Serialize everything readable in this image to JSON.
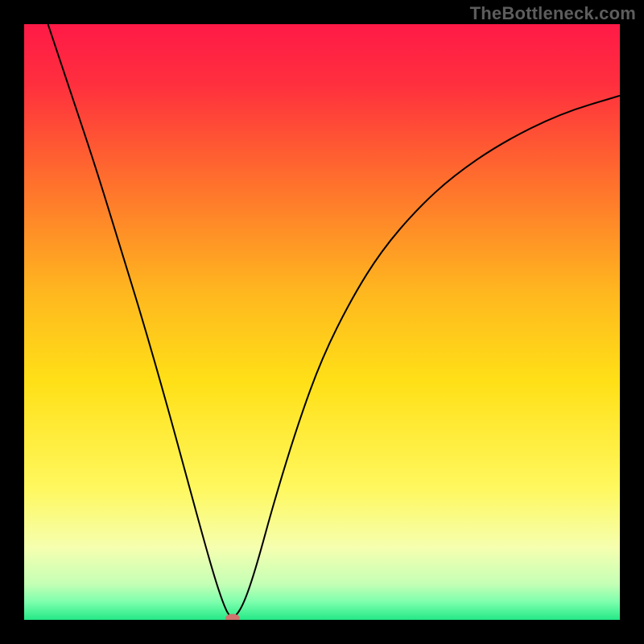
{
  "watermark": "TheBottleneck.com",
  "chart_data": {
    "type": "line",
    "title": "",
    "xlabel": "",
    "ylabel": "",
    "xlim": [
      0,
      100
    ],
    "ylim": [
      0,
      100
    ],
    "background_gradient": {
      "stops": [
        {
          "offset": 0.0,
          "color": "#ff1a47"
        },
        {
          "offset": 0.1,
          "color": "#ff2f3e"
        },
        {
          "offset": 0.25,
          "color": "#ff6a2e"
        },
        {
          "offset": 0.45,
          "color": "#ffb71f"
        },
        {
          "offset": 0.6,
          "color": "#ffe017"
        },
        {
          "offset": 0.78,
          "color": "#fff85f"
        },
        {
          "offset": 0.88,
          "color": "#f5ffb0"
        },
        {
          "offset": 0.94,
          "color": "#c4ffb5"
        },
        {
          "offset": 0.97,
          "color": "#7dffad"
        },
        {
          "offset": 1.0,
          "color": "#24e886"
        }
      ]
    },
    "series": [
      {
        "name": "bottleneck-curve",
        "color": "#000000",
        "stroke_width": 2,
        "points": [
          {
            "x": 4.0,
            "y": 100.0
          },
          {
            "x": 8.0,
            "y": 88.0
          },
          {
            "x": 12.0,
            "y": 76.0
          },
          {
            "x": 16.0,
            "y": 63.0
          },
          {
            "x": 20.0,
            "y": 50.0
          },
          {
            "x": 24.0,
            "y": 36.0
          },
          {
            "x": 27.0,
            "y": 25.0
          },
          {
            "x": 30.0,
            "y": 14.0
          },
          {
            "x": 32.0,
            "y": 7.0
          },
          {
            "x": 33.5,
            "y": 2.5
          },
          {
            "x": 34.5,
            "y": 0.5
          },
          {
            "x": 35.5,
            "y": 0.5
          },
          {
            "x": 37.0,
            "y": 3.0
          },
          {
            "x": 39.0,
            "y": 9.0
          },
          {
            "x": 42.0,
            "y": 20.0
          },
          {
            "x": 46.0,
            "y": 33.0
          },
          {
            "x": 50.0,
            "y": 44.0
          },
          {
            "x": 55.0,
            "y": 54.0
          },
          {
            "x": 60.0,
            "y": 62.0
          },
          {
            "x": 66.0,
            "y": 69.0
          },
          {
            "x": 72.0,
            "y": 74.5
          },
          {
            "x": 80.0,
            "y": 80.0
          },
          {
            "x": 90.0,
            "y": 85.0
          },
          {
            "x": 100.0,
            "y": 88.0
          }
        ]
      }
    ],
    "marker": {
      "name": "minimum-marker",
      "x": 35.0,
      "y": 0.3,
      "rx": 1.2,
      "ry": 0.7,
      "fill": "#cf746e"
    }
  }
}
